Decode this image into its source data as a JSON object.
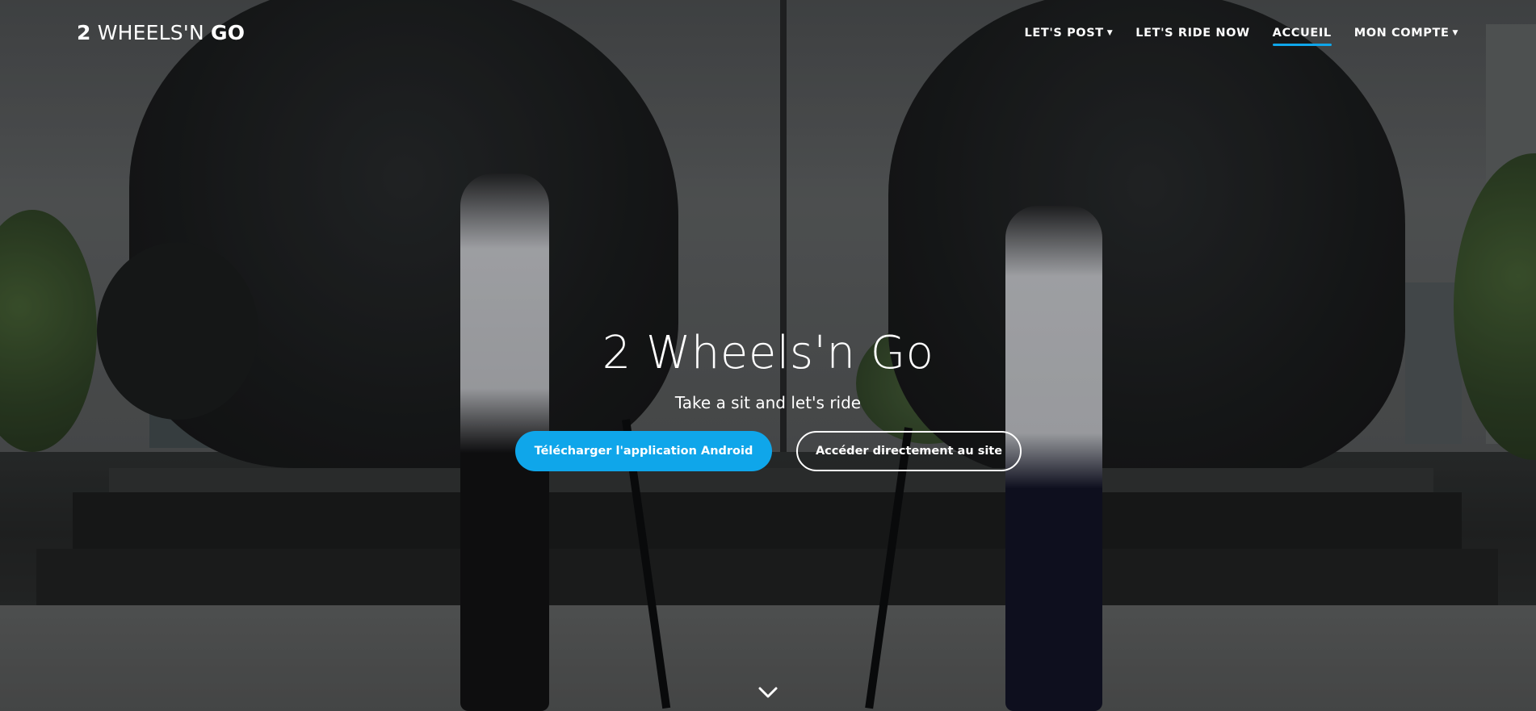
{
  "brand": {
    "bold_prefix": "2",
    "middle": "WHEELS'N",
    "bold_suffix": "GO"
  },
  "nav": {
    "items": [
      {
        "label": "LET'S POST",
        "dropdown": true
      },
      {
        "label": "LET'S RIDE NOW",
        "dropdown": false
      },
      {
        "label": "ACCUEIL",
        "dropdown": false,
        "active": true
      },
      {
        "label": "MON COMPTE",
        "dropdown": true
      }
    ]
  },
  "hero": {
    "title": "2 Wheels'n Go",
    "subtitle": "Take a sit and let's ride",
    "primary_button": "Télécharger l'application Android",
    "secondary_button": "Accéder directement au site"
  },
  "icons": {
    "scroll": "chevron-down-icon",
    "caret": "caret-down-icon"
  },
  "colors": {
    "accent": "#0fa6ea"
  }
}
